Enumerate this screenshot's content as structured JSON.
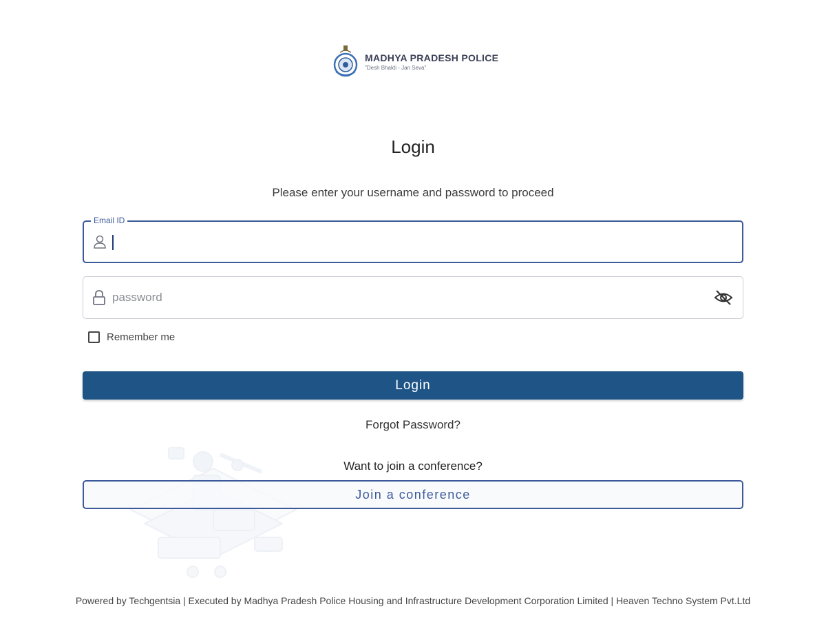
{
  "brand": {
    "name": "MADHYA PRADESH POLICE",
    "motto": "\"Desh Bhakti - Jan Seva\"",
    "emblem_icon": "police-emblem-icon"
  },
  "login": {
    "title": "Login",
    "subtitle": "Please enter your username and password to proceed",
    "email": {
      "label": "Email ID",
      "value": "",
      "icon": "user-icon"
    },
    "password": {
      "placeholder": "password",
      "value": "",
      "icon": "lock-icon",
      "toggle_icon": "eye-off-icon"
    },
    "remember_label": "Remember me",
    "remember_checked": false,
    "submit_label": "Login",
    "forgot_label": "Forgot Password?"
  },
  "conference": {
    "prompt": "Want to join a conference?",
    "button_label": "Join a conference"
  },
  "footer": {
    "text": "Powered by Techgentsia | Executed by Madhya Pradesh Police Housing and Infrastructure Development Corporation Limited | Heaven Techno System Pvt.Ltd"
  },
  "colors": {
    "primary": "#1f5487",
    "accent_border": "#3c5a9a",
    "background": "#ffffff"
  }
}
